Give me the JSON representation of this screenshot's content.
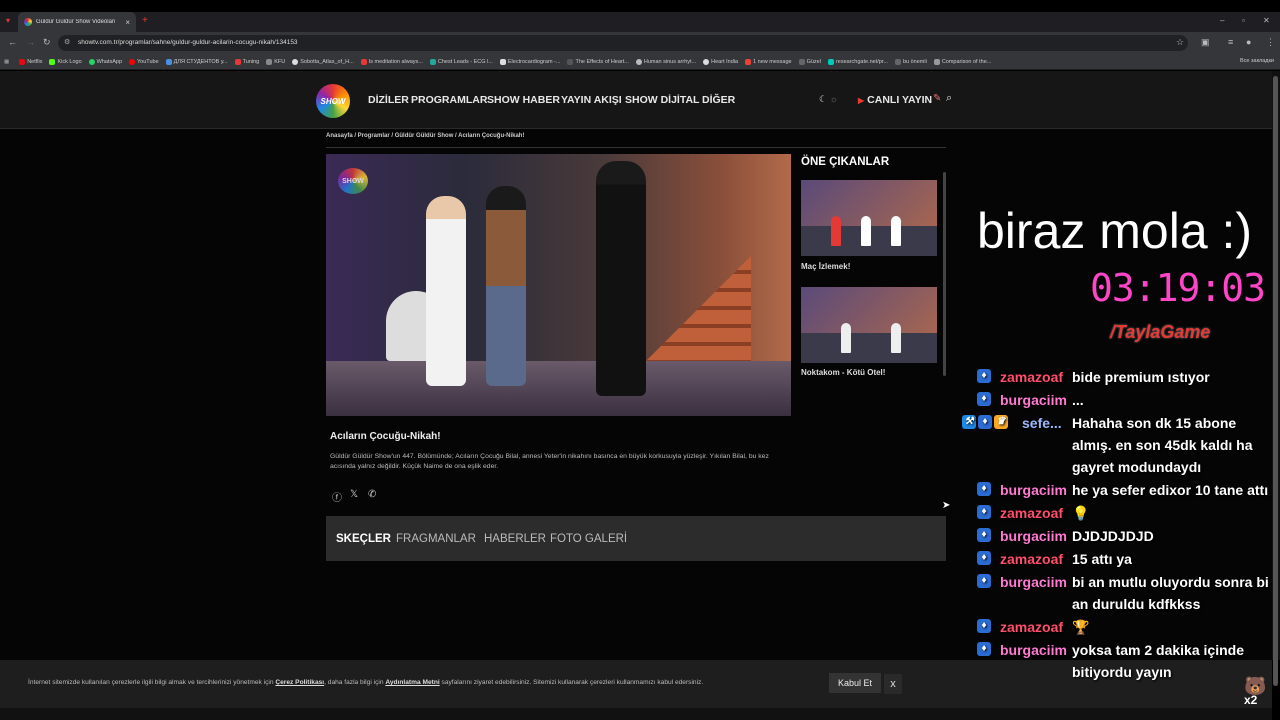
{
  "browser": {
    "tab_title": "Güldür Güldür Show Videoları",
    "tab_close": "×",
    "new_tab": "+",
    "url": "showtv.com.tr/programlar/sahne/guldur-guldur-acilarin-cocugu-nikah/134153",
    "bookmarks": [
      "Netflix",
      "Kick Logo",
      "WhatsApp",
      "YouTube",
      "ДЛЯ СТУДЕНТОВ у...",
      "Tuning",
      "KFU",
      "Sobotta_Atlas_of_H...",
      "Is meditation always...",
      "Chest Leads - ECG l...",
      "Electrocardiogram -...",
      "The Effects of Heart...",
      "Human sinus arrhyt...",
      "Heart India",
      "1 new message",
      "Güzel",
      "researchgate.net/pr...",
      "bu önemli",
      "Comparison of the..."
    ],
    "bookmarks_all": "Все закладки"
  },
  "site": {
    "logo_text": "SHOW",
    "nav": [
      "DİZİLER",
      "PROGRAMLAR",
      "SHOW HABER",
      "YAYIN AKIŞI",
      "SHOW DİJİTAL",
      "DİĞER"
    ],
    "live_label": "CANLI YAYIN",
    "breadcrumb": "Anasayfa / Programlar / Güldür Güldür Show / Acıların Çocuğu-Nikah!",
    "featured_title": "ÖNE ÇIKANLAR",
    "featured_items": [
      {
        "label": "Maç İzlemek!"
      },
      {
        "label": "Noktakom - Kötü Otel!"
      }
    ],
    "video_title": "Acıların Çocuğu-Nikah!",
    "video_description": "Güldür Güldür Show'un 447. Bölümünde; Acıların Çocuğu Bilal, annesi Yeter'in nikahını basınca en büyük korkusuyla yüzleşir. Yıkılan Bilal, bu kez acısında yalnız değildir. Küçük Naime de ona eşlik eder.",
    "tabs": [
      "SKEÇLER",
      "FRAGMANLAR",
      "HABERLER",
      "FOTO GALERİ"
    ],
    "cookie": {
      "text_a": "İnternet sitemizde kullanılan çerezlerle ilgili bilgi almak ve tercihlerinizi yönetmek için ",
      "link_a": "Çerez Politikası",
      "text_b": ", daha fazla bilgi için ",
      "link_b": "Aydınlatma Metni",
      "text_c": " sayfalarını ziyaret edebilirsiniz. Sitemizi kullanarak çerezleri kullanmamızı kabul edersiniz.",
      "accept": "Kabul Et",
      "close": "x"
    }
  },
  "overlay": {
    "title": "biraz mola :)",
    "timer": "03:19:03",
    "logo": "TaylaGame",
    "chat": [
      {
        "user": "zamazoaf",
        "color": "#ff4f6a",
        "text": "bide premium ıstıyor"
      },
      {
        "user": "burgaciim",
        "color": "#ff7ad1",
        "text": "..."
      },
      {
        "user": "sefe...",
        "color": "#9bb8ff",
        "text": "Hahaha son dk 15 abone almış. en son 45dk kaldı ha gayret modundaydı"
      },
      {
        "user": "burgaciim",
        "color": "#ff7ad1",
        "text": "he ya sefer edixor 10 tane attı"
      },
      {
        "user": "zamazoaf",
        "color": "#ff4f6a",
        "text": "💡"
      },
      {
        "user": "burgaciim",
        "color": "#ff7ad1",
        "text": "DJDJDJDJD"
      },
      {
        "user": "zamazoaf",
        "color": "#ff4f6a",
        "text": "15 attı ya"
      },
      {
        "user": "burgaciim",
        "color": "#ff7ad1",
        "text": "bi an mutlu oluyordu sonra bi an duruldu kdfkkss"
      },
      {
        "user": "zamazoaf",
        "color": "#ff4f6a",
        "text": "🏆"
      },
      {
        "user": "burgaciim",
        "color": "#ff7ad1",
        "text": "yoksa tam 2 dakika içinde bitiyordu yayın"
      }
    ],
    "corner_label": "x2"
  }
}
